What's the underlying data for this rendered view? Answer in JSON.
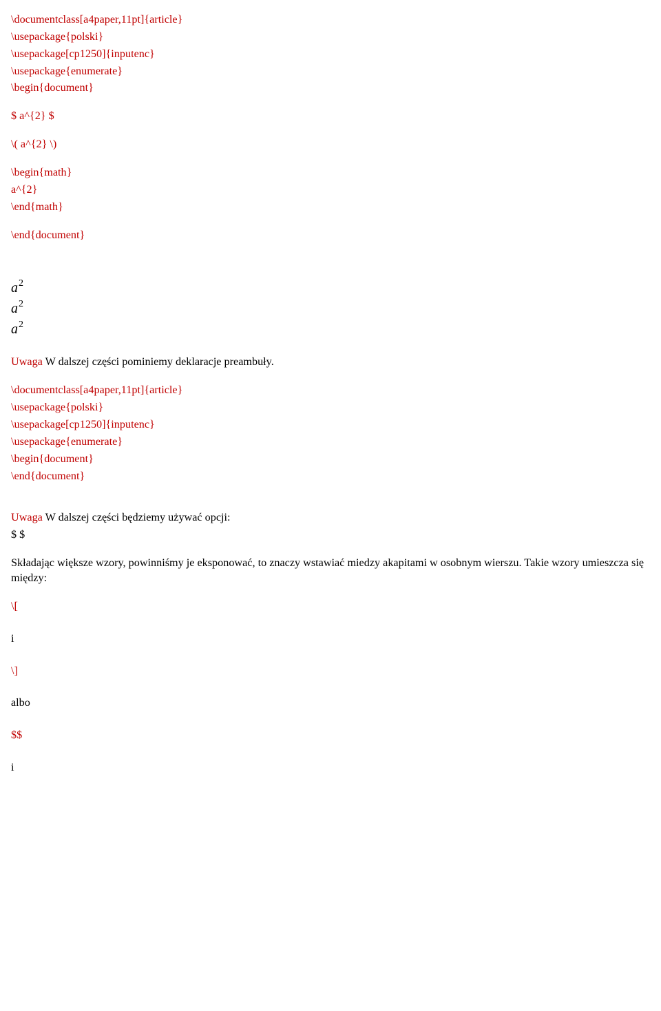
{
  "block1": {
    "l1": "\\documentclass[a4paper,11pt]{article}",
    "l2": "\\usepackage{polski}",
    "l3": "\\usepackage[cp1250]{inputenc}",
    "l4": "\\usepackage{enumerate}",
    "l5": "\\begin{document}",
    "l6": "$ a^{2} $",
    "l7": "\\( a^{2} \\)",
    "l8": "\\begin{math}",
    "l9": "a^{2}",
    "l10": "\\end{math}",
    "l11": "\\end{document}"
  },
  "math": {
    "base": "a",
    "sup": "2"
  },
  "note1": {
    "prefix": "Uwaga ",
    "rest": "W dalszej części pominiemy deklaracje preambuły."
  },
  "block2": {
    "l1": "\\documentclass[a4paper,11pt]{article}",
    "l2": "\\usepackage{polski}",
    "l3": "\\usepackage[cp1250]{inputenc}",
    "l4": "\\usepackage{enumerate}",
    "l5": "\\begin{document}",
    "l6": "\\end{document}"
  },
  "note2": {
    "prefix": "Uwaga ",
    "rest": "W dalszej części będziemy używać opcji:"
  },
  "dollar": "$ $",
  "para2": "Składając większe wzory, powinniśmy je eksponować, to znaczy wstawiać miedzy akapitami w osobnym wierszu. Takie wzory umieszcza się między:",
  "br_open": "\\[",
  "br_close": "\\]",
  "i1": "i",
  "i2": "i",
  "albo": "albo",
  "ddollar": "$$"
}
